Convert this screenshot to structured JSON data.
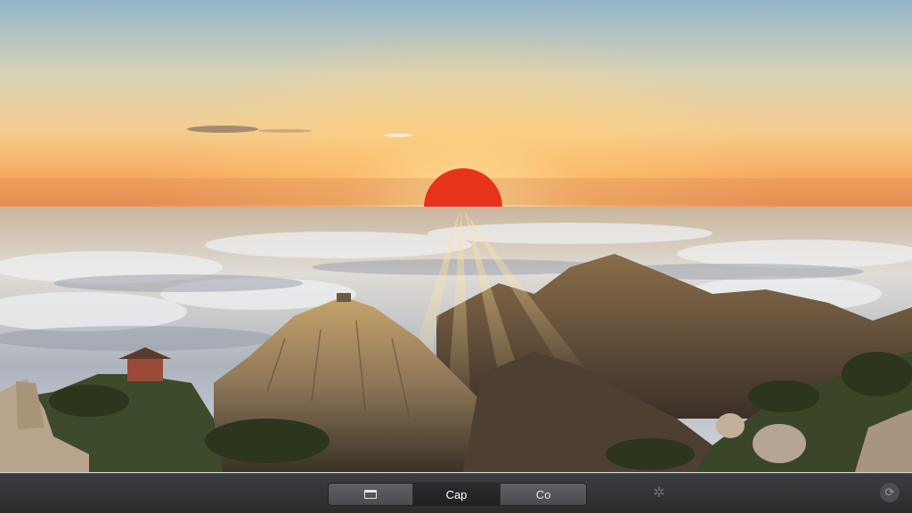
{
  "scene": {
    "subject": "sunrise-over-sea-of-clouds",
    "colors": {
      "sky_top": "#8eb4cc",
      "sky_mid": "#f2cf94",
      "horizon": "#f59a47",
      "sun": "#e8321a",
      "cloud": "#cfd3d8",
      "rock": "#8f7c62",
      "pine": "#2f3a20"
    }
  },
  "toolbar": {
    "segments": [
      {
        "label": "",
        "icon": "window-icon",
        "active": false
      },
      {
        "label": "Cap",
        "active": true
      },
      {
        "label": "Co",
        "active": false
      }
    ],
    "settings_icon": "gear-icon",
    "refresh_icon": "refresh-icon"
  }
}
